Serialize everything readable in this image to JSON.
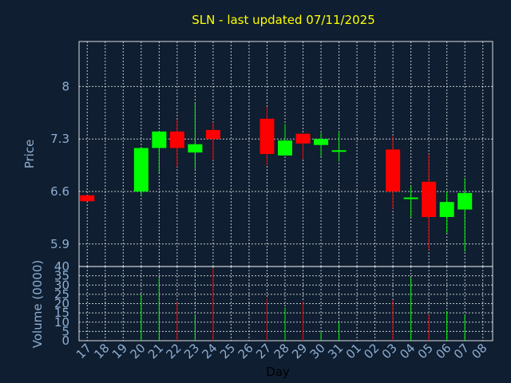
{
  "chart_data": [
    {
      "type": "candlestick",
      "title": "SLN - last updated 07/11/2025",
      "ylabel": "Price",
      "ylim": [
        5.6,
        8.6
      ],
      "yticks": [
        5.9,
        6.6,
        7.3,
        8
      ],
      "ytick_labels": [
        "5.9",
        "6.6",
        "7.3",
        "8"
      ],
      "grid": true,
      "x": [
        "17",
        "18",
        "19",
        "20",
        "21",
        "22",
        "23",
        "24",
        "25",
        "26",
        "27",
        "28",
        "29",
        "30",
        "31",
        "01",
        "02",
        "03",
        "04",
        "05",
        "06",
        "07",
        "08"
      ],
      "candles": [
        {
          "day": "17",
          "open": 6.55,
          "close": 6.47,
          "high": 6.55,
          "low": 6.47
        },
        {
          "day": "20",
          "open": 6.6,
          "close": 7.18,
          "high": 7.18,
          "low": 6.55
        },
        {
          "day": "21",
          "open": 7.18,
          "close": 7.4,
          "high": 7.4,
          "low": 6.85
        },
        {
          "day": "22",
          "open": 7.4,
          "close": 7.18,
          "high": 7.56,
          "low": 6.93
        },
        {
          "day": "23",
          "open": 7.12,
          "close": 7.23,
          "high": 7.78,
          "low": 6.9
        },
        {
          "day": "24",
          "open": 7.42,
          "close": 7.3,
          "high": 7.52,
          "low": 7.02
        },
        {
          "day": "27",
          "open": 7.57,
          "close": 7.1,
          "high": 7.73,
          "low": 6.95
        },
        {
          "day": "28",
          "open": 7.08,
          "close": 7.28,
          "high": 7.5,
          "low": 7.08
        },
        {
          "day": "29",
          "open": 7.37,
          "close": 7.24,
          "high": 7.37,
          "low": 7.03
        },
        {
          "day": "30",
          "open": 7.22,
          "close": 7.3,
          "high": 7.38,
          "low": 7.07
        },
        {
          "day": "31",
          "open": 7.13,
          "close": 7.15,
          "high": 7.4,
          "low": 7.0
        },
        {
          "day": "03",
          "open": 7.16,
          "close": 6.6,
          "high": 7.34,
          "low": 6.37
        },
        {
          "day": "04",
          "open": 6.5,
          "close": 6.52,
          "high": 6.67,
          "low": 6.26
        },
        {
          "day": "05",
          "open": 6.73,
          "close": 6.26,
          "high": 7.1,
          "low": 5.82
        },
        {
          "day": "06",
          "open": 6.26,
          "close": 6.46,
          "high": 6.6,
          "low": 6.05
        },
        {
          "day": "07",
          "open": 6.36,
          "close": 6.58,
          "high": 6.78,
          "low": 5.8
        }
      ]
    },
    {
      "type": "bar",
      "ylabel": "Volume (0000)",
      "xlabel": "Day",
      "ylim": [
        0,
        40
      ],
      "yticks": [
        0,
        5,
        10,
        15,
        20,
        25,
        30,
        35,
        40
      ],
      "ytick_labels": [
        "0",
        "5",
        "10",
        "15",
        "20",
        "25",
        "30",
        "35",
        "40"
      ],
      "categories": [
        "17",
        "18",
        "19",
        "20",
        "21",
        "22",
        "23",
        "24",
        "25",
        "26",
        "27",
        "28",
        "29",
        "30",
        "31",
        "01",
        "02",
        "03",
        "04",
        "05",
        "06",
        "07",
        "08"
      ],
      "values": [
        {
          "day": "20",
          "value": 25,
          "direction": "up"
        },
        {
          "day": "21",
          "value": 34,
          "direction": "up"
        },
        {
          "day": "22",
          "value": 21,
          "direction": "down"
        },
        {
          "day": "23",
          "value": 14,
          "direction": "up"
        },
        {
          "day": "24",
          "value": 39,
          "direction": "down"
        },
        {
          "day": "27",
          "value": 23,
          "direction": "down"
        },
        {
          "day": "28",
          "value": 18,
          "direction": "up"
        },
        {
          "day": "29",
          "value": 21,
          "direction": "down"
        },
        {
          "day": "30",
          "value": 5,
          "direction": "up"
        },
        {
          "day": "31",
          "value": 10,
          "direction": "up"
        },
        {
          "day": "03",
          "value": 22,
          "direction": "down"
        },
        {
          "day": "04",
          "value": 34,
          "direction": "up"
        },
        {
          "day": "05",
          "value": 14,
          "direction": "down"
        },
        {
          "day": "06",
          "value": 16,
          "direction": "up"
        },
        {
          "day": "07",
          "value": 14,
          "direction": "up"
        }
      ]
    }
  ],
  "colors": {
    "background": "#0f1e30",
    "up": "#00ff00",
    "down": "#ff0000",
    "title": "#ffff00",
    "axis_text": "#8eaed2",
    "grid": "#ffffff"
  }
}
